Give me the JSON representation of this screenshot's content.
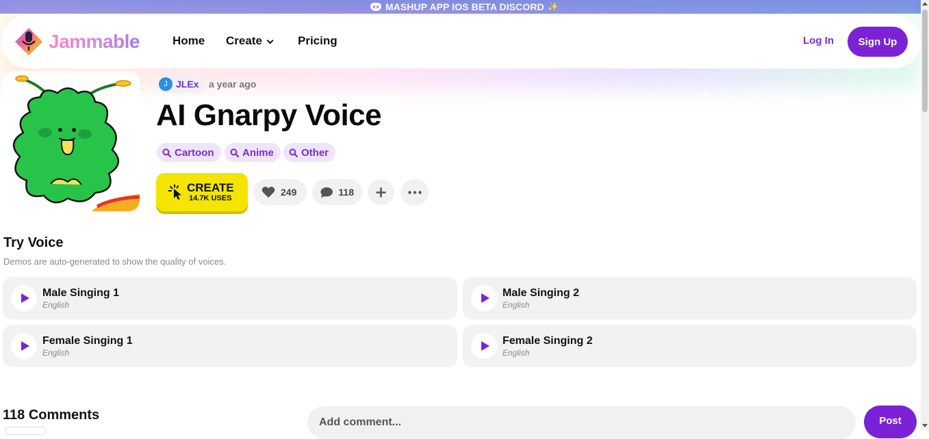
{
  "banner": {
    "text": "MASHUP APP IOS BETA DISCORD",
    "icon_left": "discord-icon",
    "icon_right": "pointer-click-icon"
  },
  "header": {
    "brand": "Jammable",
    "nav": {
      "home": "Home",
      "create": "Create",
      "pricing": "Pricing"
    },
    "login": "Log In",
    "signup": "Sign Up"
  },
  "voice": {
    "author_initial": "J",
    "author": "JLEx",
    "time_ago": "a year ago",
    "title": "AI Gnarpy Voice",
    "tags": [
      "Cartoon",
      "Anime",
      "Other"
    ],
    "create_label": "CREATE",
    "create_uses": "14.7K USES",
    "likes": "249",
    "comments": "118"
  },
  "try_voice": {
    "title": "Try Voice",
    "subtitle": "Demos are auto-generated to show the quality of voices.",
    "demos": [
      {
        "name": "Male Singing 1",
        "language": "English"
      },
      {
        "name": "Male Singing 2",
        "language": "English"
      },
      {
        "name": "Female Singing 1",
        "language": "English"
      },
      {
        "name": "Female Singing 2",
        "language": "English"
      }
    ]
  },
  "comments_section": {
    "title": "118 Comments",
    "placeholder": "Add comment...",
    "post_label": "Post"
  },
  "colors": {
    "accent": "#7b22d6",
    "create_yellow": "#f4e400",
    "tag_bg": "#efe5fb",
    "brand_gradient_start": "#f08ac8",
    "brand_gradient_end": "#a779e6"
  }
}
